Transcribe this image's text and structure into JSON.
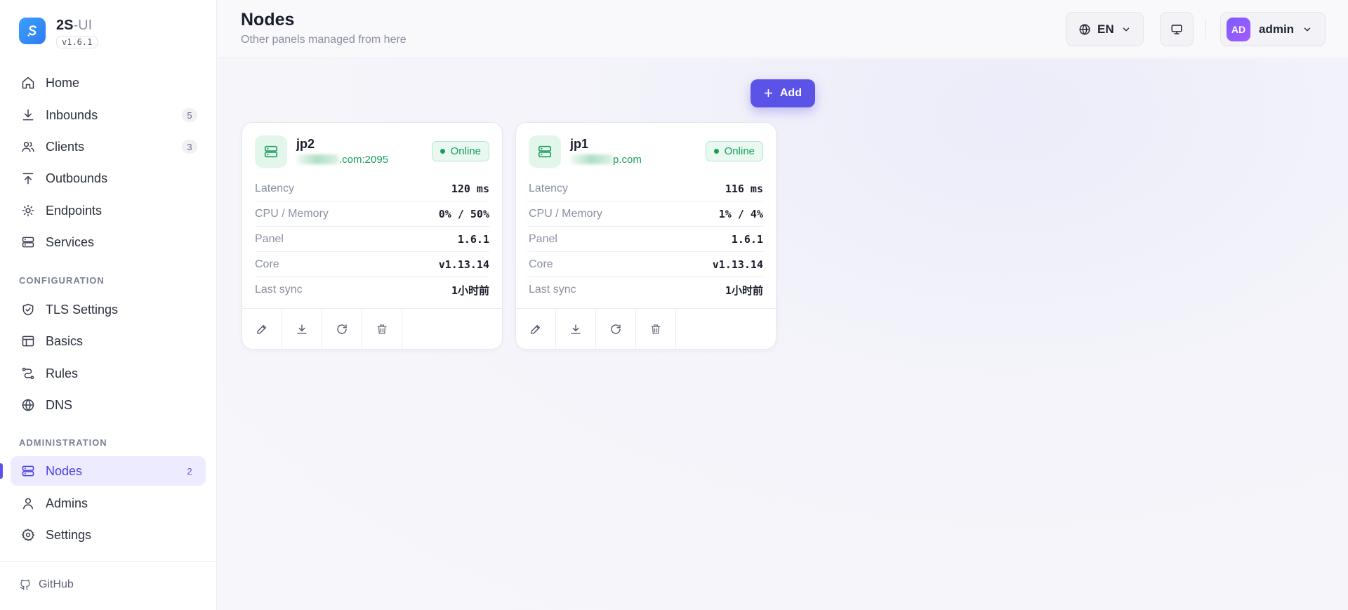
{
  "brand": {
    "name_main": "2S",
    "name_suffix": "-UI",
    "version": "v1.6.1"
  },
  "sidebar": {
    "items": [
      {
        "label": "Home",
        "icon": "home-icon"
      },
      {
        "label": "Inbounds",
        "icon": "download-icon",
        "badge": "5"
      },
      {
        "label": "Clients",
        "icon": "users-icon",
        "badge": "3"
      },
      {
        "label": "Outbounds",
        "icon": "upload-icon"
      },
      {
        "label": "Endpoints",
        "icon": "sun-icon"
      },
      {
        "label": "Services",
        "icon": "server-icon"
      }
    ],
    "configuration_title": "CONFIGURATION",
    "configuration_items": [
      {
        "label": "TLS Settings",
        "icon": "shield-check-icon"
      },
      {
        "label": "Basics",
        "icon": "table-icon"
      },
      {
        "label": "Rules",
        "icon": "route-icon"
      },
      {
        "label": "DNS",
        "icon": "globe-icon"
      }
    ],
    "administration_title": "ADMINISTRATION",
    "administration_items": [
      {
        "label": "Nodes",
        "icon": "server-icon",
        "badge": "2",
        "active": true
      },
      {
        "label": "Admins",
        "icon": "user-icon"
      },
      {
        "label": "Settings",
        "icon": "gear-icon"
      }
    ],
    "footer_link": "GitHub"
  },
  "header": {
    "title": "Nodes",
    "subtitle": "Other panels managed from here",
    "language": "EN",
    "user_initials": "AD",
    "user_name": "admin"
  },
  "main": {
    "add_label": "Add",
    "labels": {
      "latency": "Latency",
      "cpu_memory": "CPU / Memory",
      "panel": "Panel",
      "core": "Core",
      "last_sync": "Last sync"
    },
    "nodes": [
      {
        "name": "jp2",
        "host_visible": ".com:2095",
        "status": "Online",
        "latency": "120 ms",
        "cpu_memory": "0% / 50%",
        "panel": "1.6.1",
        "core": "v1.13.14",
        "last_sync": "1小时前"
      },
      {
        "name": "jp1",
        "host_visible": "p.com",
        "status": "Online",
        "latency": "116 ms",
        "cpu_memory": "1% / 4%",
        "panel": "1.6.1",
        "core": "v1.13.14",
        "last_sync": "1小时前"
      }
    ]
  },
  "colors": {
    "accent": "#5b52e8",
    "online_green": "#14a058",
    "brand_blue": "#2f7bf3"
  }
}
